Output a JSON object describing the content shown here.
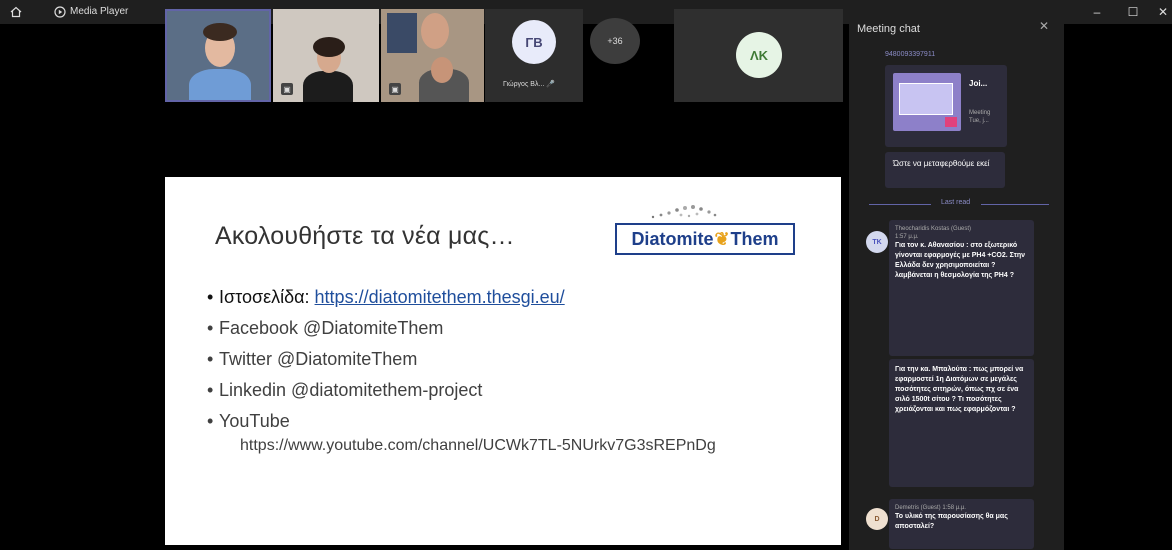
{
  "window": {
    "title": "Media Player",
    "controls": {
      "minimize": "–",
      "maximize": "☐",
      "close": "✕"
    }
  },
  "participants": {
    "gb": {
      "initials": "ΓΒ",
      "name": "Γιώργος Βλ..."
    },
    "overflow": "+36",
    "lk": {
      "initials": "ΛΚ"
    }
  },
  "slide": {
    "title": "Ακολουθήστε τα νέα μας…",
    "logo": {
      "word1": "Diatomite",
      "word2": "Them"
    },
    "bullets": [
      {
        "label": "Ιστοσελίδα: ",
        "link": "https://diatomitethem.thesgi.eu/"
      },
      {
        "label": "Facebook @DiatomiteThem"
      },
      {
        "label": "Twitter @DiatomiteThem"
      },
      {
        "label": "Linkedin @diatomitethem-project"
      },
      {
        "label": "YouTube"
      }
    ],
    "youtube_url": "https://www.youtube.com/channel/UCWk7TL-5NUrkv7G3sREPnDg"
  },
  "chat": {
    "title": "Meeting chat",
    "close": "✕",
    "link_id": "9480093397911",
    "card": {
      "title": "Joi...",
      "sub": "Meeting\nTue, j..."
    },
    "message_1": "Ώστε να μεταφερθούμε εκεί",
    "last_read": "Last read",
    "msg_theo": {
      "avatar": "TK",
      "sender": "Theocharidis Kostas (Guest)",
      "time": "1:57 μ.μ.",
      "body": "Για τον κ. Αθανασίου : στο εξωτερικό γίνονται εφαρμογές με PH4 +CO2. Στην Ελλάδα δεν χρησιμοποιείται ? λαμβάνεται η θεσμολογία της PH4 ?"
    },
    "msg_theo2": {
      "body": "Για την κα. Μπαλούτα : πως μπορεί να εφαρμοστεί 1η Διατόμων σε μεγάλες ποσότητες σιτηρών, όπως πχ σε ένα σιλό 1500t σίτου ? Τι ποσότητες χρειάζονται και πως εφαρμόζονται ?"
    },
    "msg_dem": {
      "avatar": "D",
      "sender": "Demetris (Guest)",
      "time": "1:58 μ.μ.",
      "body": "Το υλικό της παρουσίασης θα μας αποσταλεί?"
    }
  }
}
